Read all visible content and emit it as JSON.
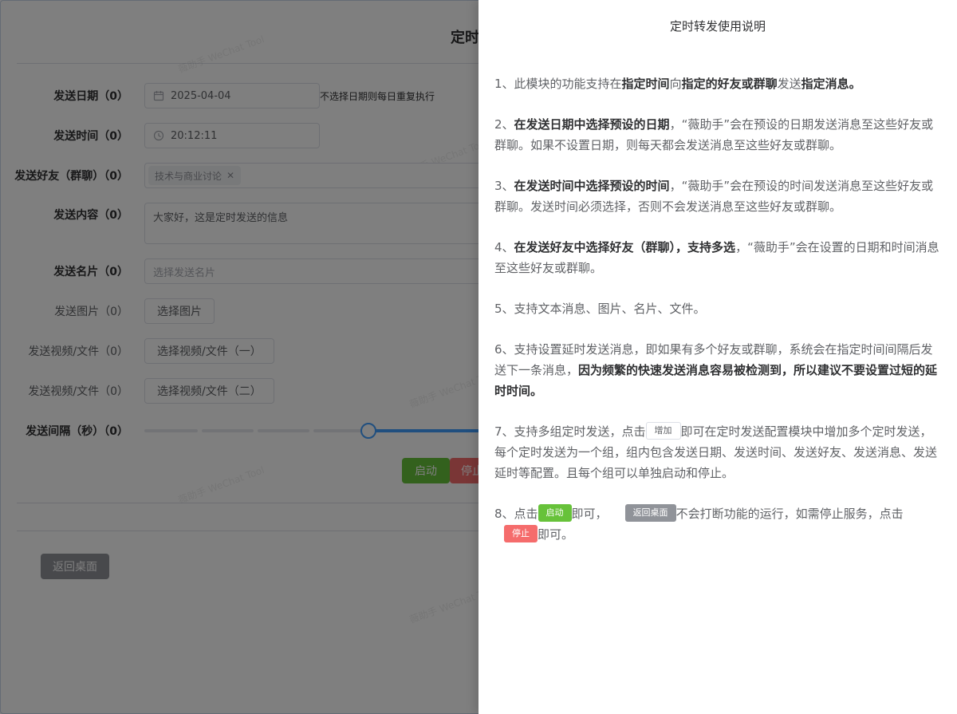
{
  "page": {
    "title": "定时转发配置",
    "title_visible": "定时",
    "watermark": "薇助手 WeChat Tool"
  },
  "form": {
    "date": {
      "label": "发送日期（0）",
      "value": "2025-04-04",
      "hint": "不选择日期则每日重复执行"
    },
    "time": {
      "label": "发送时间（0）",
      "value": "20:12:11"
    },
    "friends": {
      "label": "发送好友（群聊）（0）",
      "tag": "技术与商业讨论"
    },
    "content": {
      "label": "发送内容（0）",
      "value": "大家好，这是定时发送的信息"
    },
    "card": {
      "label": "发送名片（0）",
      "placeholder": "选择发送名片"
    },
    "image": {
      "label": "发送图片（0）",
      "button": "选择图片"
    },
    "video1": {
      "label": "发送视频/文件（0）",
      "button": "选择视频/文件（一）"
    },
    "video2": {
      "label": "发送视频/文件（0）",
      "button": "选择视频/文件（二）"
    },
    "interval": {
      "label": "发送间隔（秒）（0）"
    },
    "start": "启动",
    "stop": "停止"
  },
  "back_desktop": "返回桌面",
  "drawer": {
    "title": "定时转发使用说明",
    "p1": {
      "a": "1、此模块的功能支持在",
      "b": "指定时间",
      "c": "向",
      "d": "指定的好友或群聊",
      "e": "发送",
      "f": "指定消息。"
    },
    "p2": {
      "a": "2、",
      "b": "在发送日期中选择预设的日期",
      "c": "，“薇助手”会在预设的日期发送消息至这些好友或群聊。如果不设置日期，则每天都会发送消息至这些好友或群聊。"
    },
    "p3": {
      "a": "3、",
      "b": "在发送时间中选择预设的时间",
      "c": "，“薇助手”会在预设的时间发送消息至这些好友或群聊。发送时间必须选择，否则不会发送消息至这些好友或群聊。"
    },
    "p4": {
      "a": "4、",
      "b": "在发送好友中选择好友（群聊），支持多选",
      "c": "，“薇助手”会在设置的日期和时间消息至这些好友或群聊。"
    },
    "p5": "5、支持文本消息、图片、名片、文件。",
    "p6": {
      "a": "6、支持设置延时发送消息，即如果有多个好友或群聊，系统会在指定时间间隔后发送下一条消息，",
      "b": "因为频繁的快速发送消息容易被检测到，所以建议不要设置过短的延时时间。"
    },
    "p7": {
      "a": "7、支持多组定时发送，点击",
      "btn": "增加",
      "c": "即可在定时发送配置模块中增加多个定时发送，每个定时发送为一个组，组内包含发送日期、发送时间、发送好友、发送消息、发送延时等配置。且每个组可以单独启动和停止。"
    },
    "p8": {
      "a": "8、点击",
      "btn_start": "启动",
      "b": "即可，",
      "btn_desktop": "返回桌面",
      "c": "不会打断功能的运行，如需停止服务，点击",
      "btn_stop": "停止",
      "d": "即可。"
    }
  }
}
